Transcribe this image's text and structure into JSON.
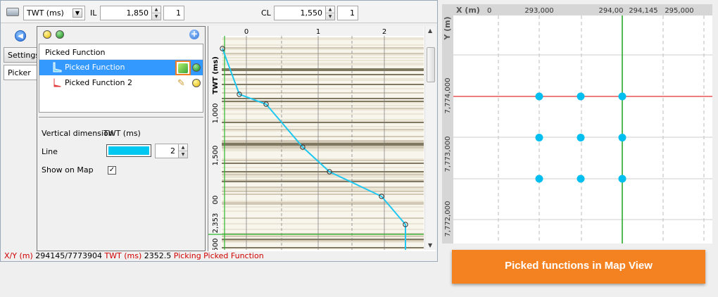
{
  "toolbar": {
    "domain_select": "TWT (ms)",
    "il_label": "IL",
    "il_value": "1,850",
    "il_step": "1",
    "cl_label": "CL",
    "cl_value": "1,550",
    "cl_step": "1"
  },
  "tabs": [
    {
      "label": "Settings"
    },
    {
      "label": "Picker"
    }
  ],
  "picker": {
    "list_header": "Picked Function",
    "items": [
      {
        "label": "Picked Function",
        "selected": true,
        "status": "green"
      },
      {
        "label": "Picked Function 2",
        "selected": false,
        "status": "yellow"
      }
    ],
    "props": {
      "vertical_dimension_label": "Vertical dimension",
      "vertical_dimension_value": "TWT (ms)",
      "line_label": "Line",
      "line_color": "#00c8f0",
      "line_width": "2",
      "show_on_map_label": "Show on Map",
      "show_on_map": true
    }
  },
  "section_plot": {
    "x_ticks": [
      "0",
      "1",
      "2"
    ],
    "y_axis_label": "TWT (ms)",
    "y_ticks": [
      "1,000",
      "1,500",
      "00",
      "2,353",
      "500"
    ],
    "picked_twt_label": "2,353",
    "curve_color": "#1ec8f0",
    "cursor_color": "#2db82d"
  },
  "status": {
    "xy_label": "X/Y (m)",
    "xy_value": "294145/7773904",
    "twt_label": "TWT (ms)",
    "twt_value": "2352.5",
    "message": "Picking Picked Function"
  },
  "map": {
    "x_axis_label": "X (m)",
    "y_axis_label": "Y (m)",
    "x_ticks": [
      "0",
      "293,000",
      "294,00",
      "294,145",
      "295,000"
    ],
    "y_ticks": [
      "7,774,000",
      "7,773,000",
      "7,772,000"
    ],
    "cursor_x_label": "294,145",
    "red_line_color": "#e03030",
    "green_line_color": "#2aa82a",
    "point_color": "#00bff0",
    "points": [
      {
        "x": 293000,
        "y": 7774000
      },
      {
        "x": 293500,
        "y": 7774000
      },
      {
        "x": 294000,
        "y": 7774000
      },
      {
        "x": 293000,
        "y": 7773500
      },
      {
        "x": 293500,
        "y": 7773500
      },
      {
        "x": 294000,
        "y": 7773500
      },
      {
        "x": 293000,
        "y": 7773000
      },
      {
        "x": 293500,
        "y": 7773000
      },
      {
        "x": 294000,
        "y": 7773000
      }
    ]
  },
  "banner": {
    "label": "Picked functions in Map View"
  }
}
